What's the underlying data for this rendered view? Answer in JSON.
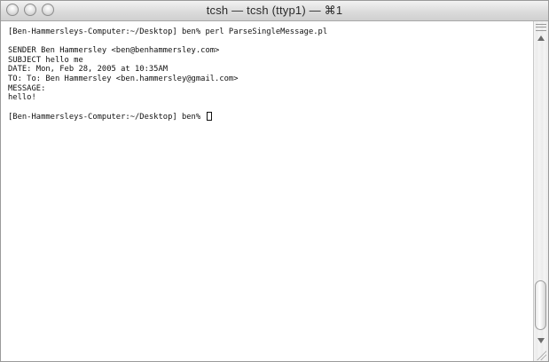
{
  "window": {
    "title": "tcsh — tcsh (ttyp1) — ⌘1"
  },
  "terminal": {
    "lines": [
      "[Ben-Hammersleys-Computer:~/Desktop] ben% perl ParseSingleMessage.pl",
      "",
      "SENDER Ben Hammersley <ben@benhammersley.com>",
      "SUBJECT hello me",
      "DATE: Mon, Feb 28, 2005 at 10:35AM",
      "TO: To: Ben Hammersley <ben.hammersley@gmail.com>",
      "MESSAGE:",
      "hello!",
      "",
      "[Ben-Hammersleys-Computer:~/Desktop] ben% "
    ]
  },
  "icons": {
    "close": "close-icon",
    "minimize": "minimize-icon",
    "zoom": "zoom-icon",
    "scroll_up": "arrow-up-icon",
    "scroll_down": "arrow-down-icon",
    "resize": "resize-grip-icon"
  }
}
